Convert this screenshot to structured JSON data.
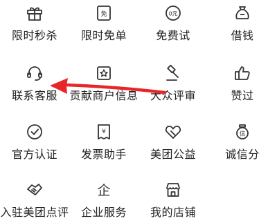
{
  "services": {
    "row1": [
      {
        "label": "限时秒杀",
        "icon": "gift-icon"
      },
      {
        "label": "限时免单",
        "icon": "free-ticket-icon",
        "glyph": "免"
      },
      {
        "label": "免费试",
        "icon": "zero-yuan-icon",
        "glyph": "0元"
      },
      {
        "label": "借钱",
        "icon": "money-bag-icon"
      }
    ],
    "row2": [
      {
        "label": "联系客服",
        "icon": "headset-icon"
      },
      {
        "label": "贡献商户信息",
        "icon": "contribute-store-icon"
      },
      {
        "label": "大众评审",
        "icon": "gavel-icon"
      },
      {
        "label": "赞过",
        "icon": "thumbs-up-icon"
      }
    ],
    "row3": [
      {
        "label": "官方认证",
        "icon": "check-circle-icon"
      },
      {
        "label": "发票助手",
        "icon": "invoice-icon",
        "glyph": "¥"
      },
      {
        "label": "美团公益",
        "icon": "heart-hands-icon"
      },
      {
        "label": "诚信分",
        "icon": "credit-badge-icon",
        "glyph": "信"
      }
    ],
    "row4": [
      {
        "label": "入驻美团点评",
        "icon": "handshake-icon"
      },
      {
        "label": "企业服务",
        "icon": "enterprise-icon",
        "glyph": "企"
      },
      {
        "label": "我的店铺",
        "icon": "storefront-icon"
      }
    ]
  },
  "annotation": {
    "icon": "red-arrow-icon",
    "color": "#e8262a",
    "points_to": "联系客服"
  },
  "colors": {
    "icon_stroke": "#333333",
    "label_text": "#222222"
  }
}
